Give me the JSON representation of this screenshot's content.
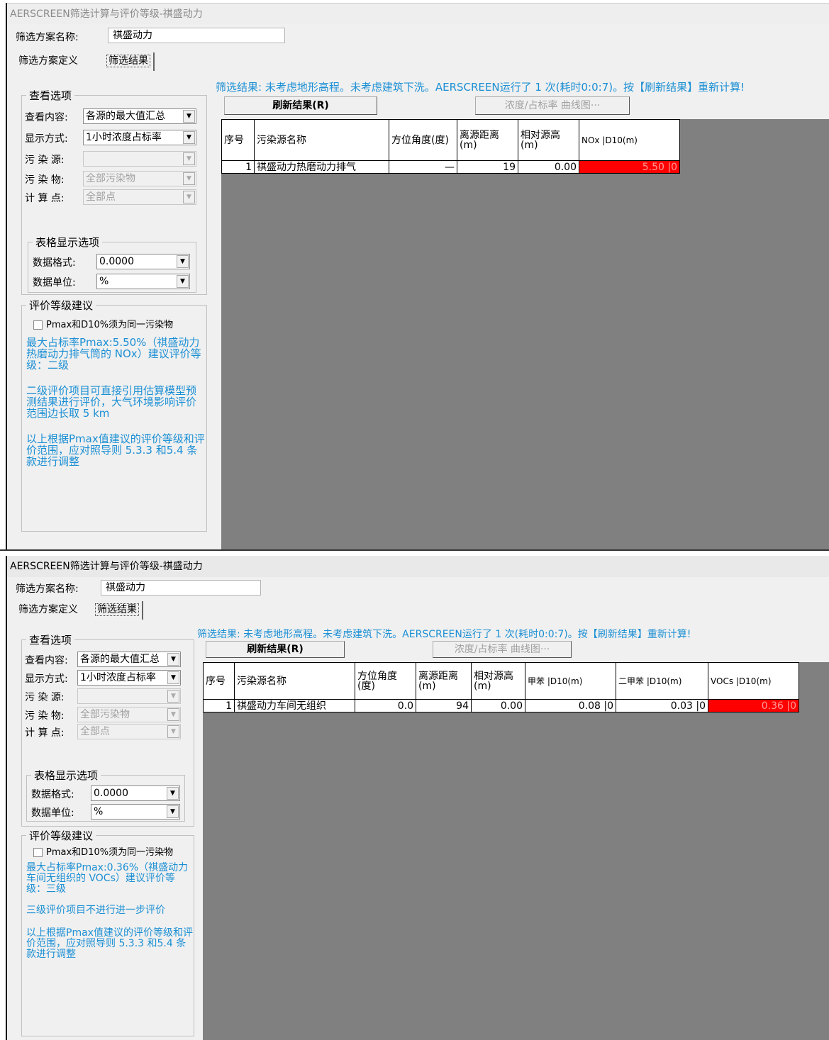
{
  "windows": [
    {
      "title": "AERSCREEN筛选计算与评价等级-祺盛动力",
      "plan_label": "筛选方案名称:",
      "plan_name": "祺盛动力",
      "tabs": [
        "筛选方案定义",
        "筛选结果"
      ],
      "view_group": "查看选项",
      "view_rows": [
        {
          "label": "查看内容:",
          "value": "各源的最大值汇总"
        },
        {
          "label": "显示方式:",
          "value": "1小时浓度占标率"
        },
        {
          "label": "污 染 源:",
          "value": ""
        },
        {
          "label": "污 染 物:",
          "value": "全部污染物"
        },
        {
          "label": "计 算 点:",
          "value": "全部点"
        }
      ],
      "table_group": "表格显示选项",
      "format_label": "数据格式:",
      "format_value": "0.0000",
      "unit_label": "数据单位:",
      "unit_value": "%",
      "eval_group": "评价等级建议",
      "checkbox_label": "Pmax和D10%须为同一污染物",
      "advice1": "最大占标率Pmax:5.50%（祺盛动力热磨动力排气筒的 NOx）建议评价等级：二级",
      "advice2": "二级评价项目可直接引用估算模型预测结果进行评价，大气环境影响评价范围边长取 5 km",
      "advice3": "以上根据Pmax值建议的评价等级和评价范围，应对照导则 5.3.3 和5.4 条款进行调整",
      "status": "筛选结果: 未考虑地形高程。未考虑建筑下洗。AERSCREEN运行了 1 次(耗时0:0:7)。按【刷新结果】重新计算!",
      "refresh_button": "刷新结果(R)",
      "curve_button": "浓度/占标率 曲线图···",
      "columns": [
        "序号",
        "污染源名称",
        "方位角度(度)",
        "离源距离(m)",
        "相对源高(m)",
        "NOx |D10(m)"
      ],
      "rows": [
        {
          "idx": "1",
          "name": "祺盛动力热磨动力排气",
          "angle": "—",
          "dist": "19",
          "height": "0.00",
          "v1": "5.50",
          "d1": "0"
        }
      ]
    },
    {
      "title": "AERSCREEN筛选计算与评价等级-祺盛动力",
      "plan_label": "筛选方案名称:",
      "plan_name": "祺盛动力",
      "tabs": [
        "筛选方案定义",
        "筛选结果"
      ],
      "view_group": "查看选项",
      "view_rows": [
        {
          "label": "查看内容:",
          "value": "各源的最大值汇总"
        },
        {
          "label": "显示方式:",
          "value": "1小时浓度占标率"
        },
        {
          "label": "污 染 源:",
          "value": ""
        },
        {
          "label": "污 染 物:",
          "value": "全部污染物"
        },
        {
          "label": "计 算 点:",
          "value": "全部点"
        }
      ],
      "table_group": "表格显示选项",
      "format_label": "数据格式:",
      "format_value": "0.0000",
      "unit_label": "数据单位:",
      "unit_value": "%",
      "eval_group": "评价等级建议",
      "checkbox_label": "Pmax和D10%须为同一污染物",
      "advice1": "最大占标率Pmax:0.36%（祺盛动力车间无组织的 VOCs）建议评价等级：三级",
      "advice2": "三级评价项目不进行进一步评价",
      "advice3": "以上根据Pmax值建议的评价等级和评价范围，应对照导则 5.3.3 和5.4 条款进行调整",
      "status": "筛选结果: 未考虑地形高程。未考虑建筑下洗。AERSCREEN运行了 1 次(耗时0:0:7)。按【刷新结果】重新计算!",
      "refresh_button": "刷新结果(R)",
      "curve_button": "浓度/占标率 曲线图···",
      "columns": [
        "序号",
        "污染源名称",
        "方位角度(度)",
        "离源距离(m)",
        "相对源高(m)",
        "甲苯 |D10(m)",
        "二甲苯 |D10(m)",
        "VOCs |D10(m)"
      ],
      "rows": [
        {
          "idx": "1",
          "name": "祺盛动力车间无组织",
          "angle": "0.0",
          "dist": "94",
          "height": "0.00",
          "v1": "0.08",
          "d1": "0",
          "v2": "0.03",
          "d2": "0",
          "v3": "0.36",
          "d3": "0"
        }
      ]
    }
  ],
  "colors": {
    "highlight": "#ff0000",
    "advice_text": "#1b8fd4",
    "grid_bg": "#808080"
  }
}
